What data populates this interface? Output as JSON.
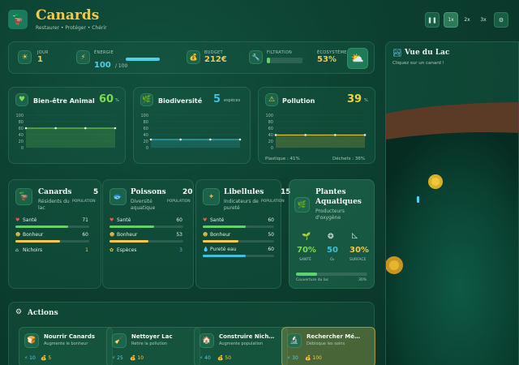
{
  "header": {
    "title": "Canards",
    "subtitle": "Restaurer • Protéger • Chérir",
    "speeds": [
      "1x",
      "2x",
      "3x"
    ]
  },
  "stats": {
    "day_label": "JOUR",
    "day_value": "1",
    "energy_label": "ÉNERGIE",
    "energy_value": "100",
    "energy_max": "/ 100",
    "energy_fraction": 1.0,
    "budget_label": "BUDGET",
    "budget_value": "212€",
    "filtration_label": "FILTRATION",
    "filtration_fraction": 0.1,
    "ecosystem_label": "ÉCOSYSTÈME",
    "ecosystem_value": "53%"
  },
  "metrics": {
    "welfare": {
      "title": "Bien-être Animal",
      "value": "60",
      "unit": "%",
      "icon": "heart-icon"
    },
    "biodiversity": {
      "title": "Biodiversité",
      "value": "5",
      "unit": "espèces",
      "icon": "leaf-icon"
    },
    "pollution": {
      "title": "Pollution",
      "value": "39",
      "unit": "%",
      "icon": "warning-icon",
      "plastic": "Plastique : 41%",
      "waste": "Déchets : 36%"
    },
    "axis_ticks": [
      "100",
      "80",
      "60",
      "40",
      "20",
      "0"
    ]
  },
  "chart_data": [
    {
      "type": "area",
      "x": [
        1,
        2,
        3,
        4
      ],
      "values": [
        60,
        60,
        60,
        60
      ],
      "ylim": [
        0,
        100
      ],
      "color": "#7ed957"
    },
    {
      "type": "area",
      "x": [
        1,
        2,
        3,
        4
      ],
      "values": [
        25,
        25,
        25,
        25
      ],
      "ylim": [
        0,
        100
      ],
      "color": "#3fc1d9"
    },
    {
      "type": "area",
      "x": [
        1,
        2,
        3,
        4
      ],
      "values": [
        39,
        39,
        39,
        39
      ],
      "ylim": [
        0,
        100
      ],
      "color": "#f2d13c"
    }
  ],
  "species": {
    "ducks": {
      "title": "Canards",
      "desc": "Résidents du lac",
      "count": "5",
      "pop_label": "POPULATION",
      "rows": [
        {
          "label": "Santé",
          "value": "71",
          "fraction": 0.71,
          "color": "#5fd36b"
        },
        {
          "label": "Bonheur",
          "value": "60",
          "fraction": 0.6,
          "color": "#f2c94c"
        }
      ],
      "extra_label": "Nichoirs",
      "extra_value": "1"
    },
    "fish": {
      "title": "Poissons",
      "desc": "Diversité aquatique",
      "count": "20",
      "pop_label": "POPULATION",
      "rows": [
        {
          "label": "Santé",
          "value": "60",
          "fraction": 0.6,
          "color": "#5fd36b"
        },
        {
          "label": "Bonheur",
          "value": "53",
          "fraction": 0.53,
          "color": "#f2c94c"
        }
      ],
      "extra_label": "Espèces",
      "extra_value": "3"
    },
    "dragonflies": {
      "title": "Libellules",
      "desc": "Indicateurs de pureté",
      "count": "15",
      "pop_label": "POPULATION",
      "rows": [
        {
          "label": "Santé",
          "value": "60",
          "fraction": 0.6,
          "color": "#5fd36b"
        },
        {
          "label": "Bonheur",
          "value": "50",
          "fraction": 0.5,
          "color": "#f2c94c"
        },
        {
          "label": "Pureté eau",
          "value": "60",
          "fraction": 0.6,
          "color": "#3fc1d9"
        }
      ]
    },
    "plants": {
      "title": "Plantes Aquatiques",
      "desc": "Producteurs d'oxygène",
      "stats": [
        {
          "value": "70%",
          "label": "SANTÉ"
        },
        {
          "value": "50",
          "label": "O₂"
        },
        {
          "value": "30%",
          "label": "SURFACE"
        }
      ],
      "coverage_label": "Couverture du lac",
      "coverage_value": "30%",
      "coverage_fraction": 0.3
    }
  },
  "actions": {
    "title": "Actions",
    "items": [
      {
        "title": "Nourrir Canards",
        "desc": "Augmente le bonheur",
        "energy": "10",
        "cost": "5"
      },
      {
        "title": "Nettoyer Lac",
        "desc": "Retire la pollution",
        "energy": "25",
        "cost": "10"
      },
      {
        "title": "Construire Nich…",
        "desc": "Augmente population",
        "energy": "40",
        "cost": "50"
      },
      {
        "title": "Rechercher Mé…",
        "desc": "Débloque les soins",
        "energy": "30",
        "cost": "100"
      }
    ]
  },
  "lake": {
    "title": "Vue du Lac",
    "hint": "Cliquez sur un canard !"
  }
}
